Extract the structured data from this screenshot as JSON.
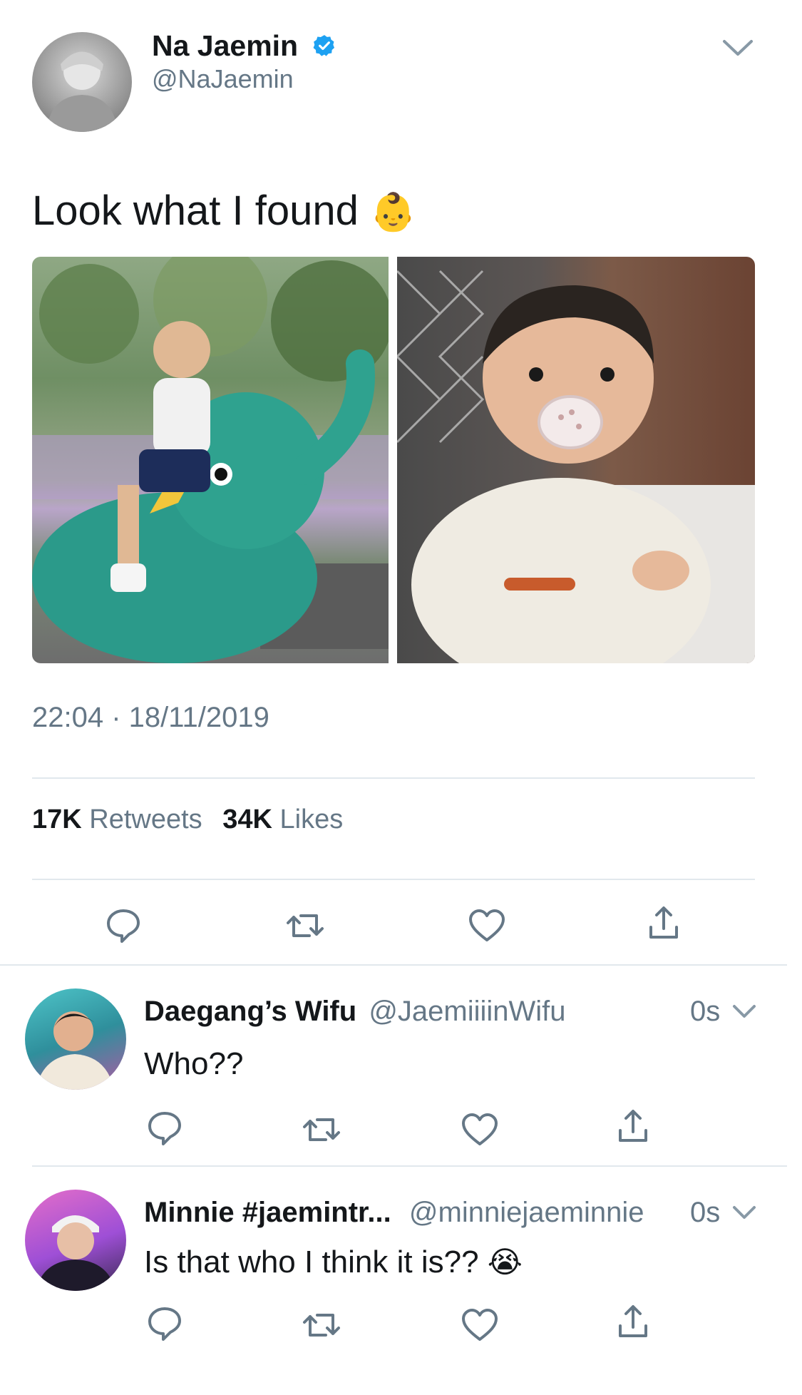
{
  "tweet": {
    "author_name": "Na Jaemin",
    "author_handle": "@NaJaemin",
    "text": "Look what I found",
    "emoji": "👶",
    "timestamp": "22:04 · 18/11/2019",
    "retweet_count": "17K",
    "retweet_label": "Retweets",
    "like_count": "34K",
    "like_label": "Likes"
  },
  "replies": [
    {
      "name": "Daegang’s Wifu",
      "handle": "@JaemiiiinWifu",
      "time": "0s",
      "text": "Who??"
    },
    {
      "name": "Minnie #jaemintr...",
      "handle": "@minniejaeminnie",
      "time": "0s",
      "text": "Is that who I think it is??",
      "emoji": "😭"
    }
  ],
  "icons": {
    "verified": "verified-badge-icon",
    "menu": "chevron-down-icon",
    "reply": "reply-icon",
    "retweet": "retweet-icon",
    "like": "heart-icon",
    "share": "share-icon"
  },
  "colors": {
    "verified": "#1da1f2",
    "secondary_text": "#657786",
    "divider": "#e1e8ed",
    "primary_text": "#14171a"
  }
}
